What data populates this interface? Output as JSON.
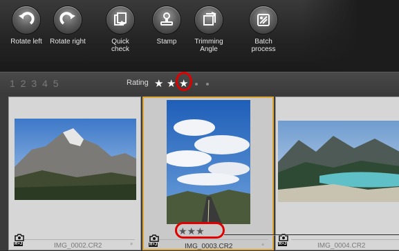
{
  "toolbar": {
    "tools": [
      {
        "label": "Rotate left",
        "icon": "rotate-left-icon"
      },
      {
        "label": "Rotate right",
        "icon": "rotate-right-icon"
      },
      {
        "label": "Quick check",
        "icon": "quick-check-icon"
      },
      {
        "label": "Stamp",
        "icon": "stamp-icon"
      },
      {
        "label": "Trimming Angle",
        "icon": "trimming-angle-icon"
      },
      {
        "label": "Batch process",
        "icon": "batch-process-icon"
      }
    ],
    "label_lines": {
      "rotate_left": "Rotate left",
      "rotate_right": "Rotate right",
      "quick_1": "Quick",
      "quick_2": "check",
      "stamp": "Stamp",
      "trim_1": "Trimming",
      "trim_2": "Angle",
      "batch_1": "Batch",
      "batch_2": "process"
    }
  },
  "rating_bar": {
    "numbers": [
      "1",
      "2",
      "3",
      "4",
      "5"
    ],
    "label": "Rating",
    "stars_filled": 3,
    "stars_total": 5,
    "star_glyph": "★"
  },
  "thumbnails": [
    {
      "filename": "IMG_0002.CR2",
      "mark": "*",
      "badge": "R+J",
      "selected": false,
      "rating": 0
    },
    {
      "filename": "IMG_0003.CR2",
      "mark": "*",
      "badge": "R+J",
      "selected": true,
      "rating": 3,
      "rating_text": "★★★"
    },
    {
      "filename": "IMG_0004.CR2",
      "mark": "",
      "badge": "R+J",
      "selected": false,
      "rating": 0
    }
  ],
  "colors": {
    "selection_border": "#e0a838",
    "annotation_red": "#e00000"
  }
}
